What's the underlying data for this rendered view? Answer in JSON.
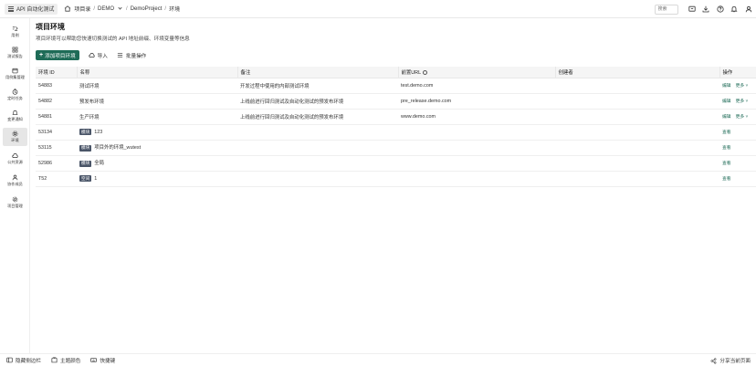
{
  "header": {
    "app_label": "API 自动化测试",
    "breadcrumb": [
      "项目录",
      "DEMO",
      "DemoProject",
      "环境"
    ],
    "search_placeholder": "搜索"
  },
  "sidebar": {
    "items": [
      {
        "label": "用例",
        "icon": "scenario-icon",
        "active": false
      },
      {
        "label": "测试报告",
        "icon": "report-icon",
        "active": false
      },
      {
        "label": "用例集管理",
        "icon": "suite-icon",
        "active": false
      },
      {
        "label": "定时任务",
        "icon": "timer-icon",
        "active": false
      },
      {
        "label": "变更通知",
        "icon": "bell-icon",
        "active": false
      },
      {
        "label": "环境",
        "icon": "environment-icon",
        "active": true
      },
      {
        "label": "公共资源",
        "icon": "cloud-icon",
        "active": false
      },
      {
        "label": "协作成员",
        "icon": "members-icon",
        "active": false
      },
      {
        "label": "项目管理",
        "icon": "settings-icon",
        "active": false
      }
    ]
  },
  "page": {
    "title": "项目环境",
    "description": "项目环境可以帮助您快速切换测试的 API 地址前缀、环境变量等信息"
  },
  "toolbar": {
    "add_label": "添加项目环境",
    "import_label": "导入",
    "batch_label": "批量操作"
  },
  "table": {
    "headers": [
      "环境 ID",
      "名称",
      "备注",
      "前置URL",
      "创建者",
      "操作"
    ],
    "rows": [
      {
        "id": "54883",
        "tag": "",
        "name": "测试环境",
        "note": "开发过程中使用的内部测试环境",
        "url": "test.demo.com",
        "creator": "",
        "action": "编辑",
        "more": "更多"
      },
      {
        "id": "54882",
        "tag": "",
        "name": "预发布环境",
        "note": "上线前进行回归测试及自动化测试的预发布环境",
        "url": "pre_release.demo.com",
        "creator": "",
        "action": "编辑",
        "more": "更多"
      },
      {
        "id": "54881",
        "tag": "",
        "name": "生产环境",
        "note": "上线前进行回归测试及自动化测试的预发布环境",
        "url": "www.demo.com",
        "creator": "",
        "action": "编辑",
        "more": "更多"
      },
      {
        "id": "53134",
        "tag": "模块",
        "name": "123",
        "note": "",
        "url": "",
        "creator": "",
        "action": "查看",
        "more": ""
      },
      {
        "id": "53115",
        "tag": "模块",
        "name": "项目外的环境_wutest",
        "note": "",
        "url": "",
        "creator": "",
        "action": "查看",
        "more": ""
      },
      {
        "id": "52986",
        "tag": "模块",
        "name": "全局",
        "note": "",
        "url": "",
        "creator": "",
        "action": "查看",
        "more": ""
      },
      {
        "id": "T52",
        "tag": "空间",
        "name": "1",
        "note": "",
        "url": "",
        "creator": "",
        "action": "查看",
        "more": ""
      }
    ]
  },
  "footer": {
    "collapse_label": "隐藏侧边栏",
    "theme_label": "主题颜色",
    "shortcut_label": "快捷键",
    "share_label": "分享当前页面"
  },
  "colors": {
    "primary": "#1e6b57",
    "tag_bg": "#4a5568",
    "header_bg": "#f5f5f5"
  }
}
